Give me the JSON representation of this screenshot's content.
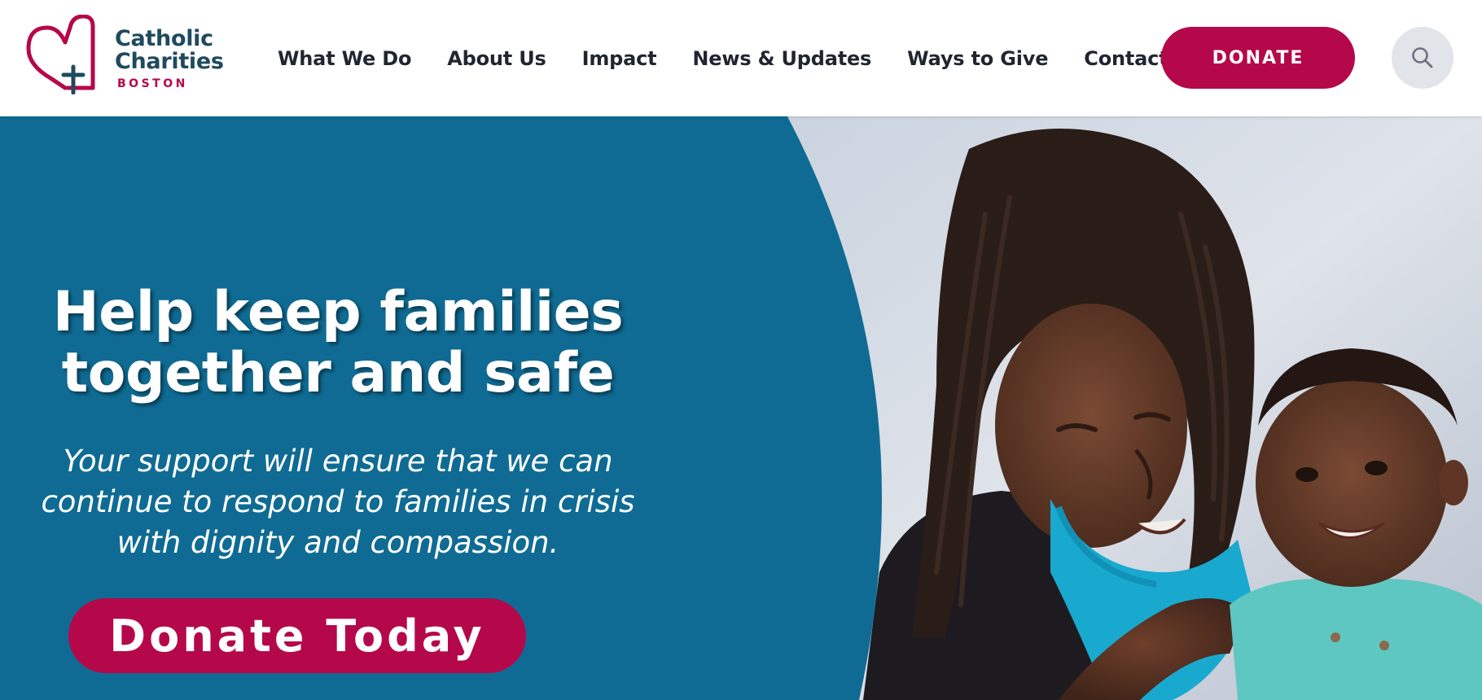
{
  "brand": {
    "name_line1": "Catholic",
    "name_line2": "Charities",
    "city": "BOSTON",
    "colors": {
      "primary": "#b5084a",
      "dark_teal": "#1f4a5e",
      "hero_blue": "#0f6b93"
    }
  },
  "nav": {
    "items": [
      {
        "label": "What We Do"
      },
      {
        "label": "About Us"
      },
      {
        "label": "Impact"
      },
      {
        "label": "News & Updates"
      },
      {
        "label": "Ways to Give"
      },
      {
        "label": "Contact"
      }
    ],
    "donate_label": "DONATE",
    "search_icon": "search-icon"
  },
  "hero": {
    "title_line1": "Help keep families",
    "title_line2": "together and safe",
    "subtitle_line1": "Your support will ensure that we can",
    "subtitle_line2": "continue to respond to families in crisis",
    "subtitle_line3": "with dignity and compassion.",
    "cta_label": "Donate Today",
    "image": "mother-and-baby-smiling-photo"
  }
}
